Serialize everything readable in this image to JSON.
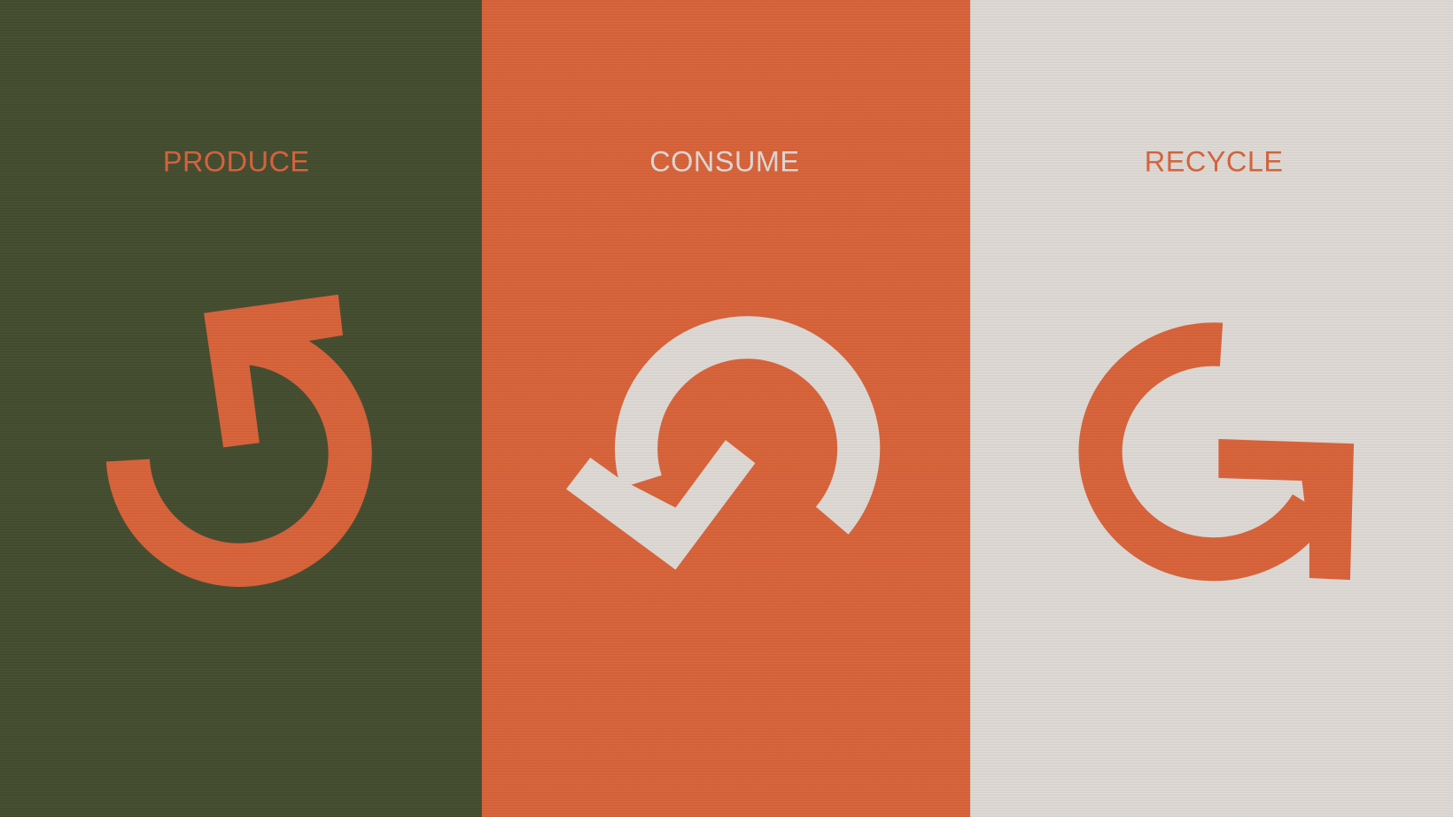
{
  "colors": {
    "green": "#454d30",
    "orange": "#d9633a",
    "light": "#dfdad5"
  },
  "panels": [
    {
      "title": "PRODUCE",
      "icon": "produce-arrow-icon"
    },
    {
      "title": "CONSUME",
      "icon": "consume-arrow-icon"
    },
    {
      "title": "RECYCLE",
      "icon": "recycle-arrow-icon"
    }
  ]
}
